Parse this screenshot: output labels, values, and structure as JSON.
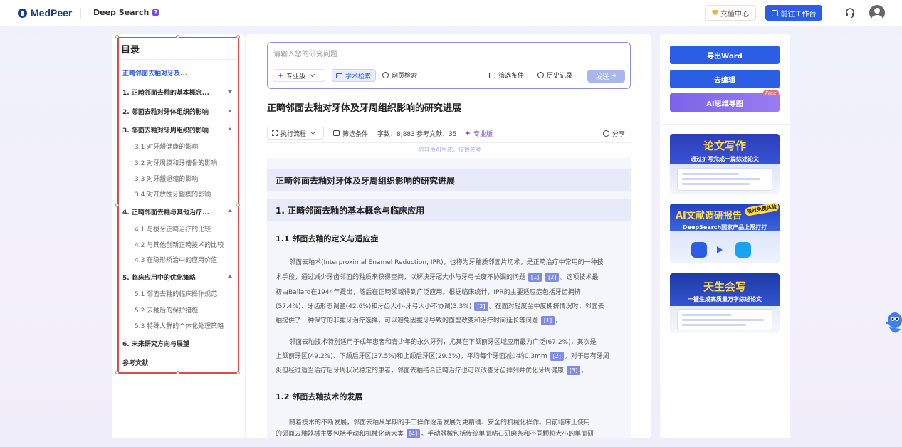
{
  "header": {
    "logo_text": "MedPeer",
    "product_name": "Deep Search",
    "product_help": "?",
    "charge_label": "充值中心",
    "workbench_label": "前往工作台"
  },
  "toc": {
    "title": "目录",
    "active_item": "正畸邻面去釉对牙及...",
    "sections": [
      {
        "label": "1.   正畸邻面去釉的基本概念...",
        "caret": "down",
        "subs": []
      },
      {
        "label": "2.   邻面去釉对牙体组织的影响",
        "caret": "down",
        "subs": []
      },
      {
        "label": "3.   邻面去釉对牙周组织的影响",
        "caret": "up",
        "subs": [
          "3.1 对牙龈健康的影响",
          "3.2 对牙周膜和牙槽骨的影响",
          "3.3 对牙龈退缩的影响",
          "3.4 对开放性牙龈楔的影响"
        ]
      },
      {
        "label": "4.   正畸邻面去釉与其他治疗...",
        "caret": "up",
        "subs": [
          "4.1 与拔牙正畸治疗的比较",
          "4.2 与其他创新正畸技术的比较",
          "4.3 在隐形矫治中的应用价值"
        ]
      },
      {
        "label": "5.   临床应用中的优化策略",
        "caret": "up",
        "subs": [
          "5.1 邻面去釉的临床操作规范",
          "5.2 去釉后的保护措施",
          "5.3 特殊人群的个体化处理策略"
        ]
      },
      {
        "label": "6.   未来研究方向与展望",
        "caret": "",
        "subs": []
      }
    ],
    "references_label": "参考文献"
  },
  "query": {
    "placeholder": "请输入您的研究问题",
    "pro_label": "专业版",
    "academic_label": "学术检索",
    "web_label": "网页检索",
    "filter_label": "筛选条件",
    "history_label": "历史记录",
    "send_label": "发送"
  },
  "doc": {
    "title": "正畸邻面去釉对牙体及牙周组织影响的研究进展",
    "toolbar": {
      "flow_label": "执行流程",
      "filter_label": "筛选条件",
      "word_count": "字数：8,883",
      "ref_count": "参考文献：35",
      "pro_label": "专业版",
      "share_label": "分享"
    },
    "ai_note": "内容由AI生成，仅供参考",
    "heading_main": "正畸邻面去釉对牙体及牙周组织影响的研究进展",
    "heading_1": "1. 正畸邻面去釉的基本概念与临床应用",
    "heading_1_1": "1.1 邻面去釉的定义与适应症",
    "p1": {
      "l1": "邻面去釉术(Interproximal Enamel Reduction, IPR)，也称为牙釉质邻面片切术，是正畸治疗中常用的一种技",
      "l2": "术手段，通过减少牙齿邻面的釉质来获得空间，以解决牙冠大小与牙弓长度不协调的问题",
      "l2_cite_a": "[1]",
      "l2_cite_b": "[2]",
      "l2_tail": "。这项技术最",
      "l3": "初由Ballard在1944年提出，随后在正畸领域得到广泛应用。根据临床统计，IPR的主要适应症包括牙齿拥挤",
      "l4": "(57.4%)、牙齿形态调整(42.6%)和牙齿大小-牙弓大小不协调(3.3%)",
      "l4_cite": "[2]",
      "l4_tail": "。在面对轻度至中度拥挤情况时，邻面去",
      "l5": "釉提供了一种保守的非拔牙治疗选择，可以避免因拔牙导致的面型改变和治疗时间延长等问题",
      "l5_cite": "[1]",
      "l5_tail": "。"
    },
    "p2": {
      "l1": "邻面去釉技术特别适用于成年患者和青少年的永久牙列，尤其在下颌前牙区域应用最为广泛(67.2%)，其次是",
      "l2": "上颌前牙区(49.2%)、下颌后牙区(37.5%)和上颌后牙区(29.5%)，平均每个牙面减少约0.3mm",
      "l2_cite": "[2]",
      "l2_tail": "。对于患有牙周",
      "l3": "炎但经过适当治疗后牙周状况稳定的患者，邻面去釉结合正畸治疗也可以改善牙齿排列并优化牙周健康",
      "l3_cite": "[3]",
      "l3_tail": "。"
    },
    "heading_1_2": "1.2 邻面去釉技术的发展",
    "p3": {
      "l1": "随着技术的不断发展，邻面去釉从早期的手工操作逐渐发展为更精确、安全的机械化操作。目前临床上使用",
      "l2": "的邻面去釉器械主要包括手动和机械化两大类",
      "l2_cite": "[4]",
      "l2_tail": "。手动器械包括传统单面粘石研磨条和不同颗粒大小的单面研"
    }
  },
  "sidebar": {
    "export_word": "导出Word",
    "edit": "去编辑",
    "mindmap": "AI思维导图",
    "free_tag": "Free",
    "promo1_title": "论文写作",
    "promo1_sub": "通过扩写完成一篇综述论文",
    "promo2_title": "AI文献调研报告",
    "promo2_sub": "DeepSearch国家产品上限打打",
    "promo2_badge": "限时免费体验",
    "promo3_title": "天生会写",
    "promo3_sub": "一键生成高质量万字综述论文"
  }
}
